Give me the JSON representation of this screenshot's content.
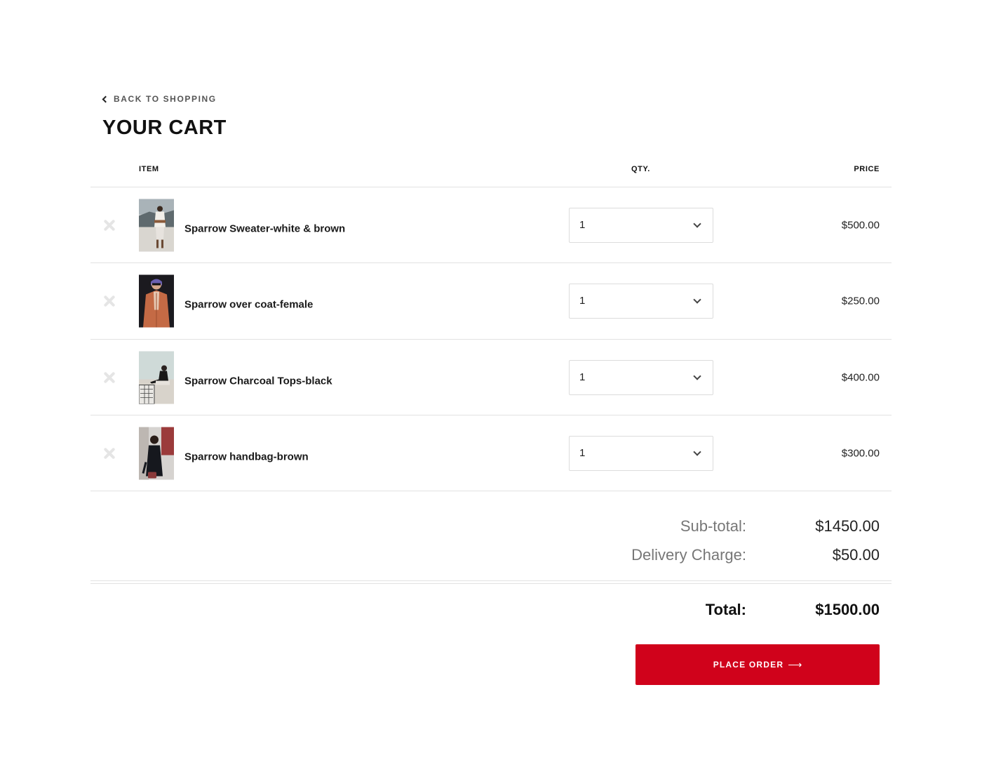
{
  "nav": {
    "back_label": "BACK TO SHOPPING",
    "back_icon": "chevron-left-icon"
  },
  "page": {
    "title": "YOUR CART"
  },
  "table": {
    "headers": {
      "item": "ITEM",
      "qty": "QTY.",
      "price": "PRICE"
    },
    "rows": [
      {
        "name": "Sparrow Sweater-white & brown",
        "qty": "1",
        "price": "$500.00",
        "thumb": "sweater-photo"
      },
      {
        "name": "Sparrow over coat-female",
        "qty": "1",
        "price": "$250.00",
        "thumb": "coat-photo"
      },
      {
        "name": "Sparrow Charcoal Tops-black",
        "qty": "1",
        "price": "$400.00",
        "thumb": "tops-photo"
      },
      {
        "name": "Sparrow handbag-brown",
        "qty": "1",
        "price": "$300.00",
        "thumb": "handbag-photo"
      }
    ]
  },
  "summary": {
    "subtotal_label": "Sub-total:",
    "subtotal_value": "$1450.00",
    "delivery_label": "Delivery Charge:",
    "delivery_value": "$50.00",
    "total_label": "Total:",
    "total_value": "$1500.00"
  },
  "actions": {
    "place_order_label": "PLACE ORDER",
    "place_order_arrow": "⟶"
  },
  "colors": {
    "accent": "#d0021b",
    "divider": "#e2e2e2",
    "remove_icon": "#e5e5e5"
  }
}
